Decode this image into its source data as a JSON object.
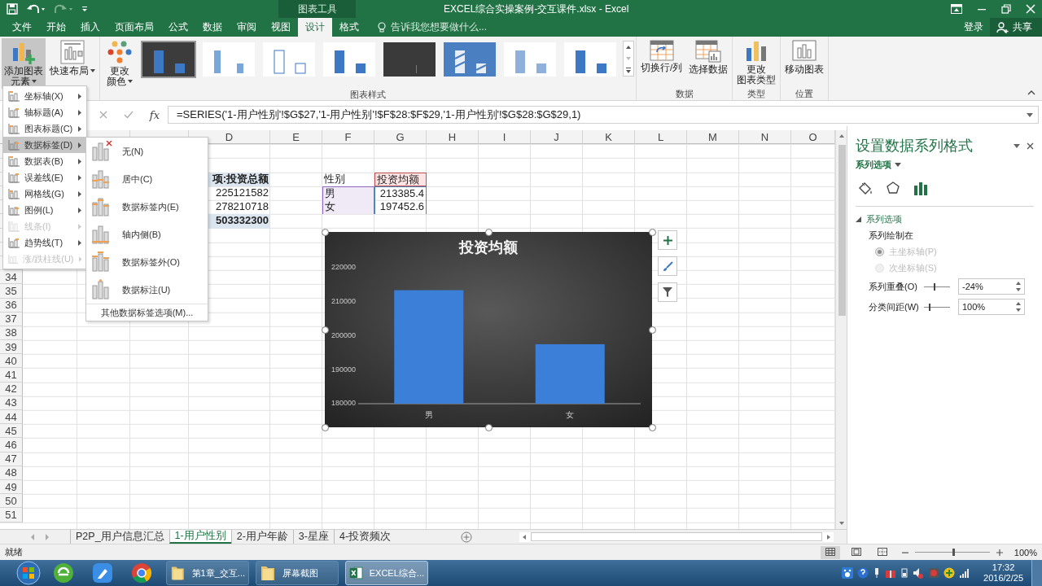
{
  "title_bar": {
    "context_group": "图表工具",
    "title": "EXCEL综合实操案例-交互课件.xlsx - Excel"
  },
  "tabs": [
    {
      "label": "文件",
      "selected": false
    },
    {
      "label": "开始",
      "selected": false
    },
    {
      "label": "插入",
      "selected": false
    },
    {
      "label": "页面布局",
      "selected": false
    },
    {
      "label": "公式",
      "selected": false
    },
    {
      "label": "数据",
      "selected": false
    },
    {
      "label": "审阅",
      "selected": false
    },
    {
      "label": "视图",
      "selected": false
    },
    {
      "label": "设计",
      "selected": true
    },
    {
      "label": "格式",
      "selected": false
    }
  ],
  "tell_me": {
    "placeholder": "告诉我您想要做什么..."
  },
  "account": {
    "sign_in": "登录",
    "share": "共享"
  },
  "ribbon": {
    "groups": [
      {
        "buttons": [
          {
            "kind": "add-element",
            "lines": [
              "添加图表",
              "元素"
            ],
            "pressed": true,
            "dropdown": true
          },
          {
            "kind": "quick-layout",
            "lines": [
              "快速布局"
            ],
            "pressed": false,
            "dropdown": true
          }
        ]
      },
      {
        "label": "图表样式",
        "buttons": [
          {
            "kind": "colors",
            "lines": [
              "更改",
              "颜色"
            ],
            "pressed": false,
            "dropdown": true
          }
        ],
        "styles": [
          {
            "kind": "dark-gradient",
            "selected": true
          },
          {
            "kind": "white-fade",
            "selected": false
          },
          {
            "kind": "outline",
            "selected": false
          },
          {
            "kind": "plain",
            "selected": false
          },
          {
            "kind": "dark",
            "selected": false
          },
          {
            "kind": "blue-hatched",
            "selected": false
          },
          {
            "kind": "light",
            "selected": false
          },
          {
            "kind": "plain",
            "selected": false
          }
        ]
      },
      {
        "label": "数据",
        "buttons": [
          {
            "kind": "switch",
            "lines": [
              "切换行/列"
            ],
            "pressed": false,
            "dropdown": false
          },
          {
            "kind": "select-data",
            "lines": [
              "选择数据"
            ],
            "pressed": false,
            "dropdown": false
          }
        ]
      },
      {
        "label": "类型",
        "buttons": [
          {
            "kind": "change-type",
            "lines": [
              "更改",
              "图表类型"
            ],
            "pressed": false,
            "dropdown": false
          }
        ]
      },
      {
        "label": "位置",
        "buttons": [
          {
            "kind": "move",
            "lines": [
              "移动图表"
            ],
            "pressed": false,
            "dropdown": false
          }
        ]
      }
    ]
  },
  "formula_bar": {
    "function_label": "fx",
    "formula": "=SERIES('1-用户性别'!$G$27,'1-用户性别'!$F$28:$F$29,'1-用户性别'!$G$28:$G$29,1)"
  },
  "sheet": {
    "columns": [
      "D",
      "E",
      "F",
      "G",
      "H",
      "I",
      "J",
      "K",
      "L",
      "M",
      "N",
      "O"
    ],
    "rows": [
      "34",
      "35",
      "36",
      "37",
      "38",
      "39",
      "40",
      "41",
      "42",
      "43",
      "44",
      "45",
      "46",
      "47",
      "48",
      "49",
      "50",
      "51"
    ],
    "pivot": [
      {
        "kind": "header",
        "text": "项:投资总额"
      },
      {
        "kind": "value",
        "text": "225121582"
      },
      {
        "kind": "value",
        "text": "278210718"
      },
      {
        "kind": "total",
        "text": "503332300"
      }
    ],
    "summary": {
      "columns": [
        "性别",
        "投资均额"
      ],
      "rows": [
        [
          "男",
          "213385.4"
        ],
        [
          "女",
          "197452.6"
        ]
      ]
    }
  },
  "chart": {
    "chart_data": {
      "type": "bar",
      "title": "投资均额",
      "categories": [
        "男",
        "女"
      ],
      "series": [
        {
          "color": "#3b7fd8",
          "values": [
            213400,
            197500
          ]
        }
      ],
      "ylim": [
        180000,
        220000
      ],
      "yticks": [
        180000,
        190000,
        200000,
        210000,
        220000
      ]
    }
  },
  "menu": {
    "items": [
      {
        "label": "坐标轴(X)",
        "selected": false,
        "disabled": false
      },
      {
        "label": "轴标题(A)",
        "selected": false,
        "disabled": false
      },
      {
        "label": "图表标题(C)",
        "selected": false,
        "disabled": false
      },
      {
        "label": "数据标签(D)",
        "selected": true,
        "disabled": false
      },
      {
        "label": "数据表(B)",
        "selected": false,
        "disabled": false
      },
      {
        "label": "误差线(E)",
        "selected": false,
        "disabled": false
      },
      {
        "label": "网格线(G)",
        "selected": false,
        "disabled": false
      },
      {
        "label": "图例(L)",
        "selected": false,
        "disabled": false
      },
      {
        "label": "线条(I)",
        "selected": false,
        "disabled": true
      },
      {
        "label": "趋势线(T)",
        "selected": false,
        "disabled": false
      },
      {
        "label": "涨/跌柱线(U)",
        "selected": false,
        "disabled": true
      }
    ]
  },
  "submenu": {
    "items": [
      {
        "label": "无(N)",
        "selected": false
      },
      {
        "label": "居中(C)",
        "selected": false
      },
      {
        "label": "数据标签内(E)",
        "selected": false
      },
      {
        "label": "轴内侧(B)",
        "selected": false
      },
      {
        "label": "数据标签外(O)",
        "selected": false
      },
      {
        "label": "数据标注(U)",
        "selected": false
      }
    ],
    "more": "其他数据标签选项(M)..."
  },
  "pane": {
    "title": "设置数据系列格式",
    "options_menu": "系列选项",
    "tabs": [
      {
        "kind": "fill",
        "selected": false
      },
      {
        "kind": "effects",
        "selected": false
      },
      {
        "kind": "series",
        "selected": true
      }
    ],
    "section": {
      "title": "系列选项",
      "expanded": true
    },
    "plot_on_label": "系列绘制在",
    "radios": [
      {
        "label": "主坐标轴(P)",
        "selected": true,
        "disabled": true
      },
      {
        "label": "次坐标轴(S)",
        "selected": false,
        "disabled": true
      }
    ],
    "spinners": [
      {
        "label": "系列重叠(O)",
        "level": 0.38,
        "value": "-24%"
      },
      {
        "label": "分类间距(W)",
        "level": 0.2,
        "value": "100%"
      }
    ]
  },
  "sheet_tabs": [
    {
      "label": "P2P_用户信息汇总",
      "selected": false
    },
    {
      "label": "1-用户性别",
      "selected": true
    },
    {
      "label": "2-用户年龄",
      "selected": false
    },
    {
      "label": "3-星座",
      "selected": false
    },
    {
      "label": "4-投资频次",
      "selected": false
    }
  ],
  "status_bar": {
    "text": "就绪",
    "views": [
      {
        "kind": "normal",
        "selected": true
      },
      {
        "kind": "page-layout",
        "selected": false
      },
      {
        "kind": "page-break",
        "selected": false
      }
    ],
    "zoom": {
      "level": 0.5,
      "value": "100%"
    }
  },
  "taskbar": {
    "pinned": [
      {
        "kind": "ie"
      },
      {
        "kind": "pen"
      },
      {
        "kind": "browser"
      }
    ],
    "windows": [
      {
        "kind": "folder",
        "label": "第1章_交互...",
        "selected": false
      },
      {
        "kind": "folder",
        "label": "屏幕截图",
        "selected": false
      },
      {
        "kind": "excel",
        "label": "EXCEL综合...",
        "selected": true
      }
    ],
    "clock": {
      "time": "17:32",
      "date": "2016/2/25"
    }
  }
}
